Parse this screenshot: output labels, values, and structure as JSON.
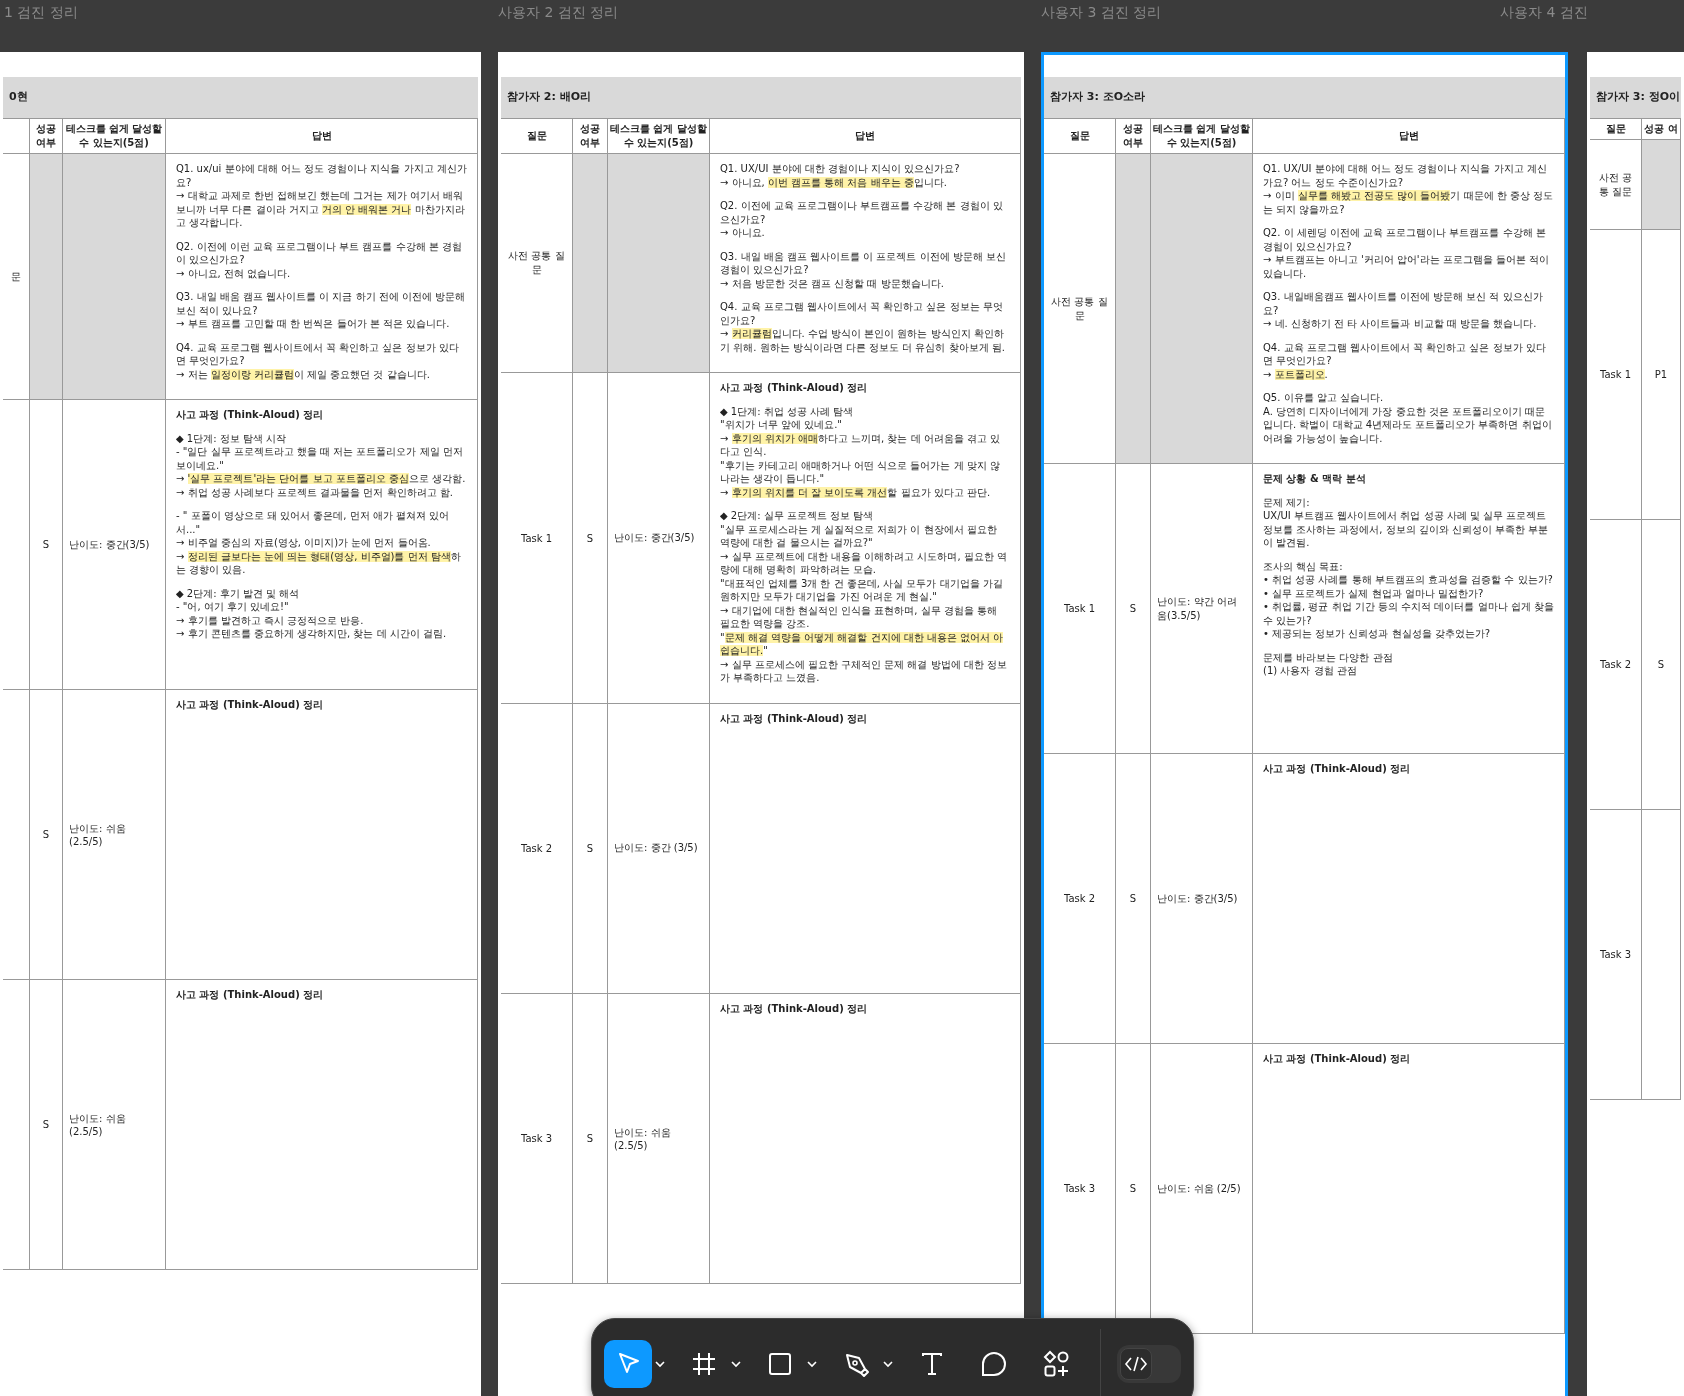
{
  "canvas_labels": [
    "1 검진 정리",
    "사용자 2 검진 정리",
    "사용자 3 검진 정리",
    "사용자 4 검진"
  ],
  "frames": [
    {
      "title": "0현",
      "selected": false,
      "kind": "cutleft",
      "columns": [
        "성공 여부",
        "테스크를 쉽게 달성할 수 있는지(5점)",
        "답변"
      ],
      "rows": [
        {
          "kind": "pre",
          "question": "문",
          "answer": [
            "Q1. ux/ui 분야에 대해 어느 정도 경험이나 지식을 가지고 계신가요?\n→ 대학교 과제로 한번 접해보긴 했는데 그거는 제가 여기서 배워보니까 너무 다른 결이라 거지고 **거의 안 배워본 거나** 마찬가지라고 생각합니다.",
            "Q2. 이전에 이런 교육 프로그램이나 부트 캠프를 수강해 본 경험이 있으신가요?\n→ 아니요, 전혀 없습니다.",
            "Q3. 내일 배움 캠프 웹사이트를 이 지금 하기 전에 이전에 방문해 보신 적이 있나요?\n→ 부트 캠프를 고민할 때 한 번씩은 들어가 본 적은 있습니다.",
            "Q4. 교육 프로그램 웹사이트에서 꼭 확인하고 싶은 정보가 있다면 무엇인가요?\n→ 저는 **일정이랑 커리큘럼**이 제일 중요했던 것 같습니다."
          ]
        },
        {
          "kind": "task",
          "success": "S",
          "difficulty": "난이도: 중간(3/5)",
          "answer": [
            "사고 과정 (Think-Aloud) 정리",
            "◆ 1단계: 정보 탐색 시작\n- \"일단 실무 프로젝트라고 했을 때 저는 포트폴리오가 제일 먼저 보이네요.\"\n→ **'실무 프로젝트'라는 단어를 보고 포트폴리오 중심**으로 생각함.\n→ 취업 성공 사례보다 프로젝트 결과물을 먼저 확인하려고 함.",
            "- \" 포폴이 영상으로 돼 있어서 좋은데, 먼저 애가 펼쳐져 있어서...\"\n→ 비주얼 중심의 자료(영상, 이미지)가 눈에 먼저 들어옴.\n→ **정리된 글보다는 눈에 띄는 형태(영상, 비주얼)를 먼저 탐색**하는 경향이 있음.",
            "◆ 2단계: 후기 발견 및 해석\n- \"어, 여기 후기 있네요!\"\n→ 후기를 발견하고 즉시 긍정적으로 반응.\n→ 후기 콘텐츠를 중요하게 생각하지만, 찾는 데 시간이 걸림."
          ]
        },
        {
          "kind": "task",
          "success": "S",
          "difficulty": "난이도: 쉬움 (2.5/5)",
          "answer": [
            "사고 과정 (Think-Aloud) 정리"
          ]
        },
        {
          "kind": "task",
          "success": "S",
          "difficulty": "난이도: 쉬움 (2.5/5)",
          "answer": [
            "사고 과정 (Think-Aloud) 정리"
          ]
        }
      ]
    },
    {
      "title": "참가자 2: 배O리",
      "selected": false,
      "kind": "full",
      "columns": [
        "질문",
        "성공 여부",
        "테스크를 쉽게 달성할 수 있는지(5점)",
        "답변"
      ],
      "rows": [
        {
          "kind": "pre",
          "question": "사전 공통 질문",
          "answer": [
            "Q1. UX/UI 분야에 대한 경험이나 지식이 있으신가요?\n→ 아니요, **이번 캠프를 통해 처음 배우는 중**입니다.",
            "Q2. 이전에 교육 프로그램이나 부트캠프를 수강해 본 경험이 있으신가요?\n→ 아니요.",
            "Q3. 내일 배움 캠프 웹사이트를 이 프로젝트 이전에 방문해 보신 경험이 있으신가요?\n→ 처음 방문한 것은 캠프 신청할 때 방문했습니다.",
            "Q4. 교육 프로그램 웹사이트에서 꼭 확인하고 싶은 정보는 무엇인가요?\n→ **커리큘럼**입니다. 수업 방식이 본인이 원하는 방식인지 확인하기 위해. 원하는 방식이라면 다른 정보도 더 유심히 찾아보게 됨."
          ]
        },
        {
          "kind": "task",
          "question": "Task 1",
          "success": "S",
          "difficulty": "난이도: 중간(3/5)",
          "answer": [
            "사고 과정 (Think-Aloud) 정리",
            "◆ 1단계: 취업 성공 사례 탐색\n\"위치가 너무 앞에 있네요.\"\n→ **후기의 위치가 애매**하다고 느끼며, 찾는 데 어려움을 겪고 있다고 인식.\n\"후기는 카테고리 애매하거나 어떤 식으로 들어가는 게 맞지 않나라는 생각이 듭니다.\"\n→ **후기의 위치를 더 잘 보이도록 개선**할 필요가 있다고 판단.",
            "◆ 2단계: 실무 프로젝트 정보 탐색\n\"실무 프로세스라는 게 실질적으로 저희가 이 현장에서 필요한 역량에 대한 걸 물으시는 걸까요?\"\n→ 실무 프로젝트에 대한 내용을 이해하려고 시도하며, 필요한 역량에 대해 명확히 파악하려는 모습.\n\"대표적인 업체를 3개 한 건 좋은데, 사실 모두가 대기업을 가길 원하지만 모두가 대기업을 가진 어려운 게 현실.\"\n→ 대기업에 대한 현실적인 인식을 표현하며, 실무 경험을 통해 필요한 역량을 강조.\n\"**문제 해결 역량을 어떻게 해결할 건지에 대한 내용은 없어서 아쉽습니다.**\"\n→ 실무 프로세스에 필요한 구체적인 문제 해결 방법에 대한 정보가 부족하다고 느꼈음."
          ]
        },
        {
          "kind": "task",
          "question": "Task 2",
          "success": "S",
          "difficulty": "난이도: 중간 (3/5)",
          "answer": [
            "사고 과정 (Think-Aloud) 정리"
          ]
        },
        {
          "kind": "task",
          "question": "Task 3",
          "success": "S",
          "difficulty": "난이도: 쉬움 (2.5/5)",
          "answer": [
            "사고 과정 (Think-Aloud) 정리"
          ]
        }
      ]
    },
    {
      "title": "참가자 3: 조O소라",
      "selected": true,
      "kind": "full",
      "columns": [
        "질문",
        "성공 여부",
        "테스크를 쉽게 달성할 수 있는지(5점)",
        "답변"
      ],
      "rows": [
        {
          "kind": "pre",
          "question": "사전 공통 질문",
          "answer": [
            "Q1. UX/UI 분야에 대해 어느 정도 경험이나 지식을 가지고 계신가요? 어느 정도 수준이신가요?\n→ 이미 **실무를 해봤고 전공도 많이 들어봤**기 때문에 한 중상 정도는 되지 않을까요?",
            "Q2. 이 세렌딩 이전에 교육 프로그램이나 부트캠프를 수강해 본 경험이 있으신가요?\n→ 부트캠프는 아니고 '커리어 압어'라는 프로그램을 들어본 적이 있습니다.",
            "Q3. 내일배움캠프 웹사이트를 이전에 방문해 보신 적 있으신가요?\n→ 네. 신청하기 전 타 사이트들과 비교할 때 방문을 했습니다.",
            "Q4. 교육 프로그램 웹사이트에서 꼭 확인하고 싶은 정보가 있다면 무엇인가요?\n→ **포트폴리오**.",
            "Q5. 이유를 알고 싶습니다.\nA. 당연히 디자이너에게 가장 중요한 것은 포트폴리오이기 때문입니다. 학벌이 대학교 4년제라도 포트폴리오가 부족하면 취업이 어려울 가능성이 높습니다."
          ]
        },
        {
          "kind": "task",
          "question": "Task 1",
          "success": "S",
          "difficulty": "난이도: 약간 어려움(3.5/5)",
          "answer": [
            "문제 상황 & 맥락 분석",
            "문제 제기:\nUX/UI 부트캠프 웹사이트에서 취업 성공 사례 및 실무 프로젝트 정보를 조사하는 과정에서, 정보의 깊이와 신뢰성이 부족한 부분이 발견됨.",
            "조사의 핵심 목표:\n• 취업 성공 사례를 통해 부트캠프의 효과성을 검증할 수 있는가?\n• 실무 프로젝트가 실제 현업과 얼마나 밀접한가?\n• 취업률, 평균 취업 기간 등의 수치적 데이터를 얼마나 쉽게 찾을 수 있는가?\n• 제공되는 정보가 신뢰성과 현실성을 갖추었는가?",
            "문제를 바라보는 다양한 관점\n(1) 사용자 경험 관점"
          ]
        },
        {
          "kind": "task",
          "question": "Task 2",
          "success": "S",
          "difficulty": "난이도: 중간(3/5)",
          "answer": [
            "사고 과정 (Think-Aloud) 정리"
          ]
        },
        {
          "kind": "task",
          "question": "Task 3",
          "success": "S",
          "difficulty": "난이도: 쉬움 (2/5)",
          "answer": [
            "사고 과정 (Think-Aloud) 정리"
          ]
        }
      ]
    },
    {
      "title": "참가자 3: 정O이",
      "selected": false,
      "kind": "cutright",
      "columns": [
        "질문",
        "성공 여"
      ],
      "rows": [
        {
          "kind": "pre",
          "question": "사전 공통 질문"
        },
        {
          "kind": "task",
          "question": "Task 1",
          "success": "P1"
        },
        {
          "kind": "task",
          "question": "Task 2",
          "success": "S"
        },
        {
          "kind": "task",
          "question": "Task 3"
        }
      ]
    }
  ],
  "toolbar": {
    "tools": [
      {
        "kind": "move",
        "selected": true,
        "menu": true
      },
      {
        "kind": "frame",
        "selected": false,
        "menu": true
      },
      {
        "kind": "shape",
        "selected": false,
        "menu": true
      },
      {
        "kind": "pen",
        "selected": false,
        "menu": true
      },
      {
        "kind": "text",
        "selected": false,
        "menu": false
      },
      {
        "kind": "comment",
        "selected": false,
        "menu": false
      },
      {
        "kind": "assets",
        "selected": false,
        "menu": false
      }
    ],
    "dev_mode": {
      "on": false
    }
  }
}
